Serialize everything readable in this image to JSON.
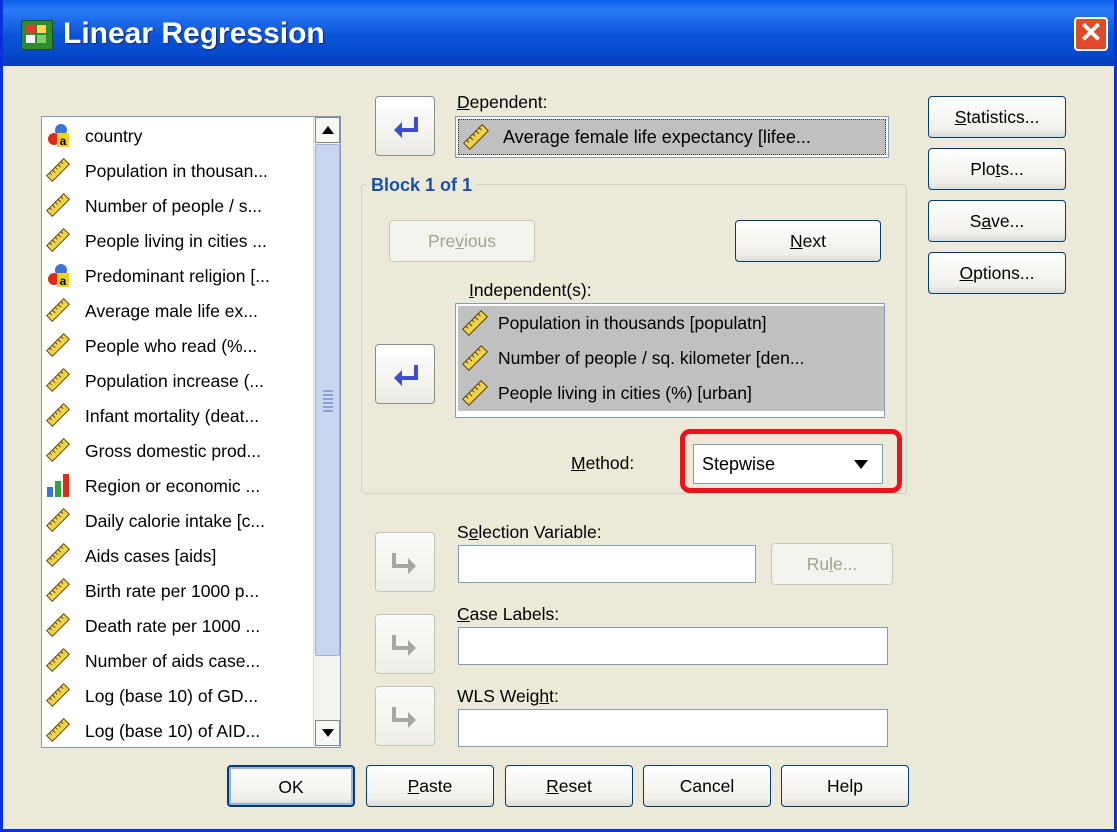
{
  "window": {
    "title": "Linear Regression",
    "close_glyph": "✕"
  },
  "variables": [
    {
      "label": "country",
      "icon": "string-nominal-icon"
    },
    {
      "label": "Population in thousan...",
      "icon": "ruler-scale-icon"
    },
    {
      "label": "Number of people / s...",
      "icon": "ruler-scale-icon"
    },
    {
      "label": "People living in cities ...",
      "icon": "ruler-scale-icon"
    },
    {
      "label": "Predominant religion [...",
      "icon": "string-nominal-icon"
    },
    {
      "label": "Average male life ex...",
      "icon": "ruler-scale-icon"
    },
    {
      "label": "People who read (%...",
      "icon": "ruler-scale-icon"
    },
    {
      "label": "Population increase (...",
      "icon": "ruler-scale-icon"
    },
    {
      "label": "Infant mortality (deat...",
      "icon": "ruler-scale-icon"
    },
    {
      "label": "Gross domestic prod...",
      "icon": "ruler-scale-icon"
    },
    {
      "label": "Region or economic ...",
      "icon": "bar-chart-ordinal-icon"
    },
    {
      "label": "Daily calorie intake [c...",
      "icon": "ruler-scale-icon"
    },
    {
      "label": "Aids cases [aids]",
      "icon": "ruler-scale-icon"
    },
    {
      "label": "Birth rate per 1000 p...",
      "icon": "ruler-scale-icon"
    },
    {
      "label": "Death rate per 1000 ...",
      "icon": "ruler-scale-icon"
    },
    {
      "label": "Number of aids case...",
      "icon": "ruler-scale-icon"
    },
    {
      "label": "Log (base 10) of GD...",
      "icon": "ruler-scale-icon"
    },
    {
      "label": "Log (base 10) of AID...",
      "icon": "ruler-scale-icon"
    }
  ],
  "dependent": {
    "label_pre": "",
    "label_key": "D",
    "label_post": "ependent:",
    "value": "Average female life expectancy [lifee..."
  },
  "block": {
    "title": "Block 1 of 1",
    "previous_pre": "Pre",
    "previous_key": "v",
    "previous_post": "ious",
    "next_pre": "",
    "next_key": "N",
    "next_post": "ext"
  },
  "independents": {
    "label_pre": "",
    "label_key": "I",
    "label_post": "ndependent(s):",
    "items": [
      "Population in thousands [populatn]",
      "Number of people / sq. kilometer [den...",
      "People living in cities (%) [urban]"
    ]
  },
  "method": {
    "label_pre": "",
    "label_key": "M",
    "label_post": "ethod:",
    "value": "Stepwise"
  },
  "selection": {
    "label_pre": "S",
    "label_key": "e",
    "label_post": "lection Variable:",
    "value": "",
    "rule_pre": "Ru",
    "rule_key": "l",
    "rule_post": "e..."
  },
  "case_labels": {
    "label_pre": "",
    "label_key": "C",
    "label_post": "ase Labels:",
    "value": ""
  },
  "wls": {
    "label_pre": "WLS Weig",
    "label_key": "h",
    "label_post": "t:",
    "value": ""
  },
  "side_buttons": {
    "statistics_pre": "",
    "statistics_key": "S",
    "statistics_post": "tatistics...",
    "plots_pre": "Plo",
    "plots_key": "t",
    "plots_post": "s...",
    "save_pre": "S",
    "save_key": "a",
    "save_post": "ve...",
    "options_pre": "",
    "options_key": "O",
    "options_post": "ptions..."
  },
  "bottom_buttons": {
    "ok": "OK",
    "paste_pre": "",
    "paste_key": "P",
    "paste_post": "aste",
    "reset_pre": "",
    "reset_key": "R",
    "reset_post": "eset",
    "cancel": "Cancel",
    "help": "Help"
  },
  "colors": {
    "accent_title": "#1a51a8",
    "highlight": "#e8131b",
    "titlebar": "#0a53d8"
  }
}
